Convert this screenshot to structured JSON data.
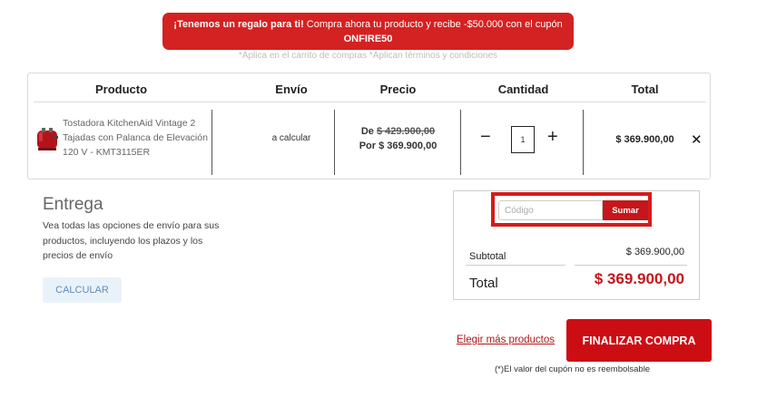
{
  "promo": {
    "bold_text": "¡Tenemos un regalo para ti!",
    "text": " Compra ahora tu producto y recibe -$50.000 con el cupón",
    "code": "ONFIRE50",
    "note": "*Aplica en el carrito de compras *Aplican términos y condiciones"
  },
  "cart": {
    "headers": {
      "product": "Producto",
      "shipping": "Envío",
      "price": "Precio",
      "quantity": "Cantidad",
      "total": "Total"
    },
    "item": {
      "name": "Tostadora KitchenAid Vintage 2 Tajadas con Palanca de Elevación 120 V - KMT3115ER",
      "shipping": "a calcular",
      "price_old_prefix": "De ",
      "price_old": "$ 429.900,00",
      "price_new": "Por $ 369.900,00",
      "quantity": "1",
      "total": "$ 369.900,00",
      "minus": "−",
      "plus": "+",
      "remove": "✕"
    }
  },
  "delivery": {
    "title": "Entrega",
    "description": "Vea todas las opciones de envío para sus productos, incluyendo los plazos y los precios de envío",
    "button": "CALCULAR"
  },
  "summary": {
    "coupon_placeholder": "Código",
    "coupon_button": "Sumar",
    "subtotal_label": "Subtotal",
    "subtotal_value": "$ 369.900,00",
    "total_label": "Total",
    "total_value": "$ 369.900,00"
  },
  "actions": {
    "more_products": "Elegir más productos",
    "finalize": "FINALIZAR COMPRA",
    "coupon_note": "(*)El valor del cupón no es reembolsable"
  },
  "colors": {
    "brand_red": "#c4161c",
    "banner_red": "#d42121"
  }
}
